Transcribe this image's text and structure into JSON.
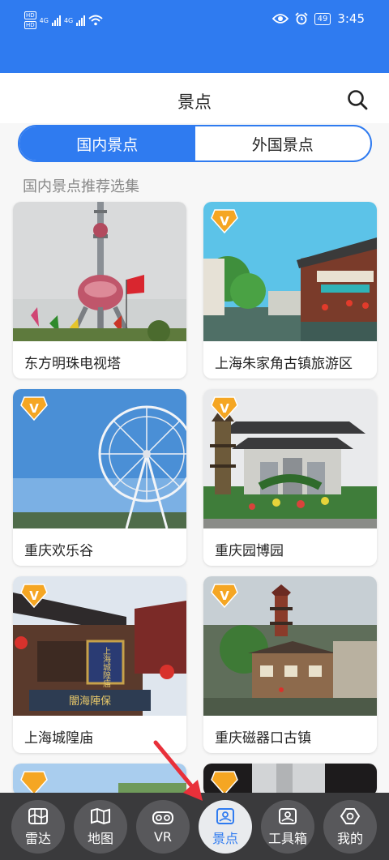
{
  "status_bar": {
    "time": "3:45",
    "battery": "49",
    "hd1": "HD",
    "hd2": "HD",
    "net1": "4G",
    "net2": "4G"
  },
  "header": {
    "title": "景点"
  },
  "tabs": [
    {
      "label": "国内景点",
      "active": true
    },
    {
      "label": "外国景点",
      "active": false
    }
  ],
  "section_title": "国内景点推荐选集",
  "attractions": [
    {
      "name": "东方明珠电视塔",
      "vip": false
    },
    {
      "name": "上海朱家角古镇旅游区",
      "vip": true,
      "vip_text": "V"
    },
    {
      "name": "重庆欢乐谷",
      "vip": true,
      "vip_text": "V"
    },
    {
      "name": "重庆园博园",
      "vip": true,
      "vip_text": "V"
    },
    {
      "name": "上海城隍庙",
      "vip": true,
      "vip_text": "V",
      "sign_text": "上海城隍庙",
      "gate_text": "闇海陣保"
    },
    {
      "name": "重庆磁器口古镇",
      "vip": true,
      "vip_text": "V"
    }
  ],
  "nav": [
    {
      "label": "雷达",
      "icon": "map-fold-icon",
      "active": false
    },
    {
      "label": "地图",
      "icon": "map-icon",
      "active": false
    },
    {
      "label": "VR",
      "icon": "vr-glasses-icon",
      "active": false
    },
    {
      "label": "景点",
      "icon": "photo-icon",
      "active": true
    },
    {
      "label": "工具箱",
      "icon": "toolbox-icon",
      "active": false
    },
    {
      "label": "我的",
      "icon": "user-icon",
      "active": false
    }
  ],
  "colors": {
    "primary": "#2f7bf0",
    "nav_bg": "#3a3a3c",
    "vip": "#f5a623",
    "arrow": "#e8303a"
  }
}
